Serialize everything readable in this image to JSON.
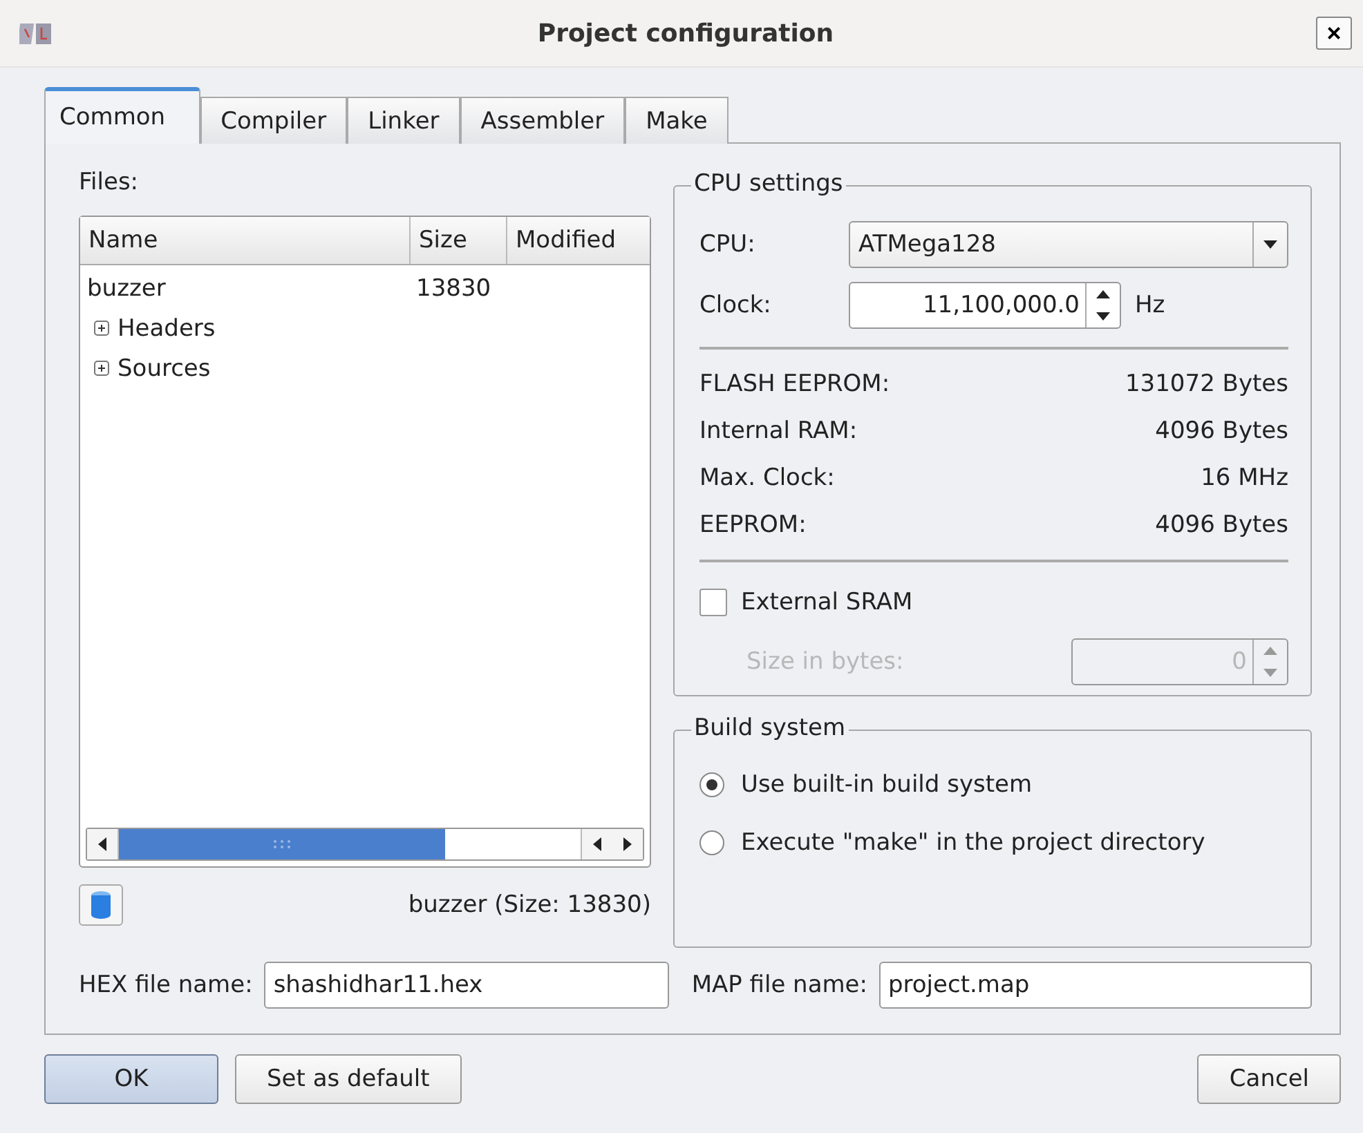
{
  "window": {
    "title": "Project configuration",
    "close": "×"
  },
  "tabs": [
    {
      "label": "Common",
      "selected": true
    },
    {
      "label": "Compiler",
      "selected": false
    },
    {
      "label": "Linker",
      "selected": false
    },
    {
      "label": "Assembler",
      "selected": false
    },
    {
      "label": "Make",
      "selected": false
    }
  ],
  "files": {
    "label": "Files:",
    "columns": [
      "Name",
      "Size",
      "Modified"
    ],
    "tree": [
      {
        "name": "buzzer",
        "size": "13830",
        "children": [
          {
            "name": "Headers",
            "expanded": false
          },
          {
            "name": "Sources",
            "expanded": false
          }
        ]
      }
    ],
    "info": "buzzer (Size: 13830)"
  },
  "cpu_settings": {
    "title": "CPU settings",
    "cpu_label": "CPU:",
    "cpu": "ATMega128",
    "clock_label": "Clock:",
    "clock": "11,100,000.0",
    "clock_unit": "Hz",
    "specs": [
      {
        "label": "FLASH EEPROM:",
        "value": "131072 Bytes"
      },
      {
        "label": "Internal RAM:",
        "value": "4096 Bytes"
      },
      {
        "label": "Max. Clock:",
        "value": "16 MHz"
      },
      {
        "label": "EEPROM:",
        "value": "4096 Bytes"
      }
    ],
    "external_sram": {
      "label": "External SRAM",
      "checked": false
    },
    "size": {
      "label": "Size in bytes:",
      "value": "0",
      "disabled": true
    }
  },
  "build_system": {
    "title": "Build system",
    "options": [
      {
        "label": "Use built-in build system",
        "selected": true
      },
      {
        "label": "Execute \"make\" in the project directory",
        "selected": false
      }
    ]
  },
  "hex_file": {
    "label": "HEX file name:",
    "value": "shashidhar11.hex"
  },
  "map_file": {
    "label": "MAP file name:",
    "value": "project.map"
  },
  "buttons": [
    {
      "label": "OK",
      "kind": "default"
    },
    {
      "label": "Set as default",
      "kind": "normal"
    },
    {
      "label": "Cancel",
      "kind": "normal"
    }
  ]
}
